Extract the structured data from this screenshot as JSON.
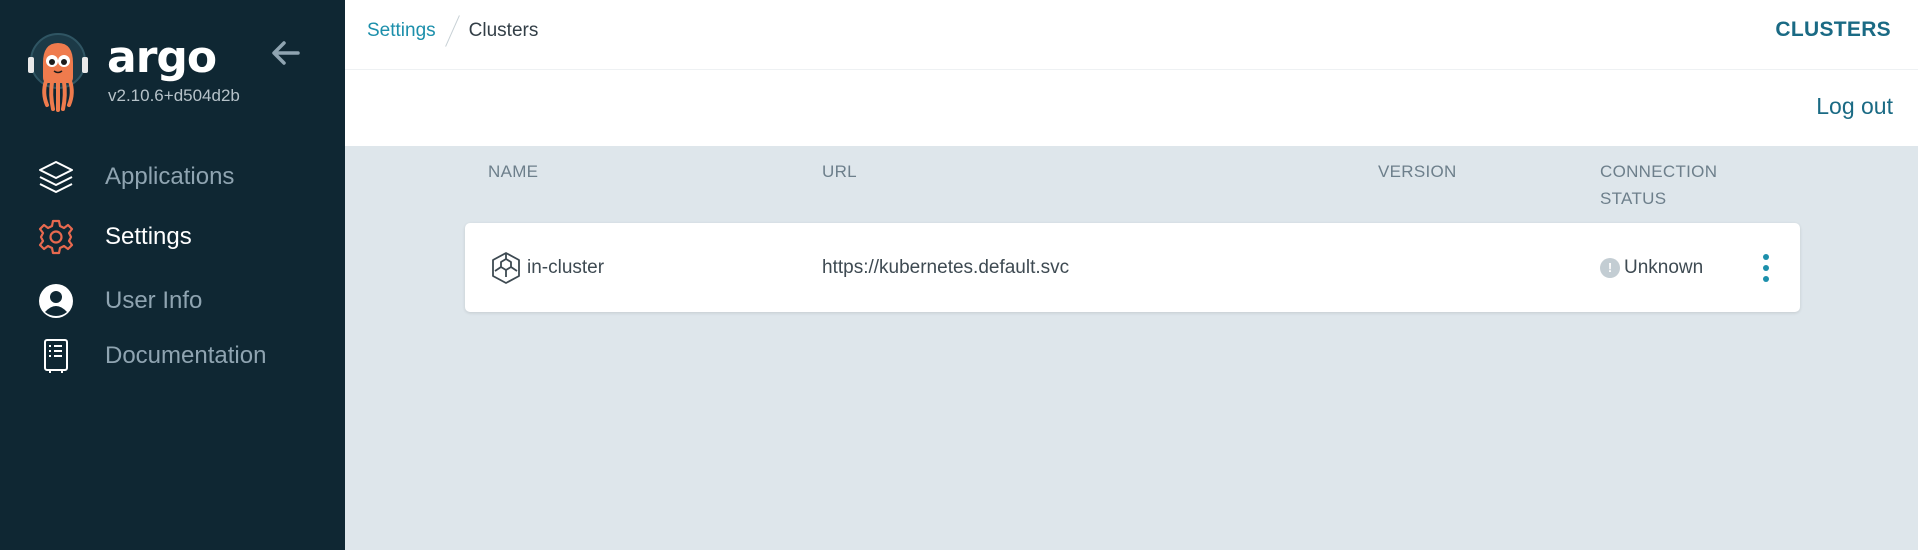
{
  "sidebar": {
    "brand": "argo",
    "version": "v2.10.6+d504d2b",
    "items": [
      {
        "label": "Applications",
        "icon": "layers-icon",
        "active": false
      },
      {
        "label": "Settings",
        "icon": "gear-icon",
        "active": true
      },
      {
        "label": "User Info",
        "icon": "user-icon",
        "active": false
      },
      {
        "label": "Documentation",
        "icon": "book-icon",
        "active": false
      }
    ]
  },
  "header": {
    "breadcrumbs": [
      "Settings",
      "Clusters"
    ],
    "title": "CLUSTERS",
    "logout_label": "Log out"
  },
  "table": {
    "columns": [
      "NAME",
      "URL",
      "VERSION",
      "CONNECTION STATUS"
    ],
    "rows": [
      {
        "name": "in-cluster",
        "url": "https://kubernetes.default.svc",
        "version": "",
        "status": "Unknown"
      }
    ]
  },
  "colors": {
    "sidebar_bg": "#0f2733",
    "accent": "#1c8fab",
    "title": "#1a6a84",
    "settings_icon": "#e9694f",
    "content_bg": "#dee6eb"
  }
}
